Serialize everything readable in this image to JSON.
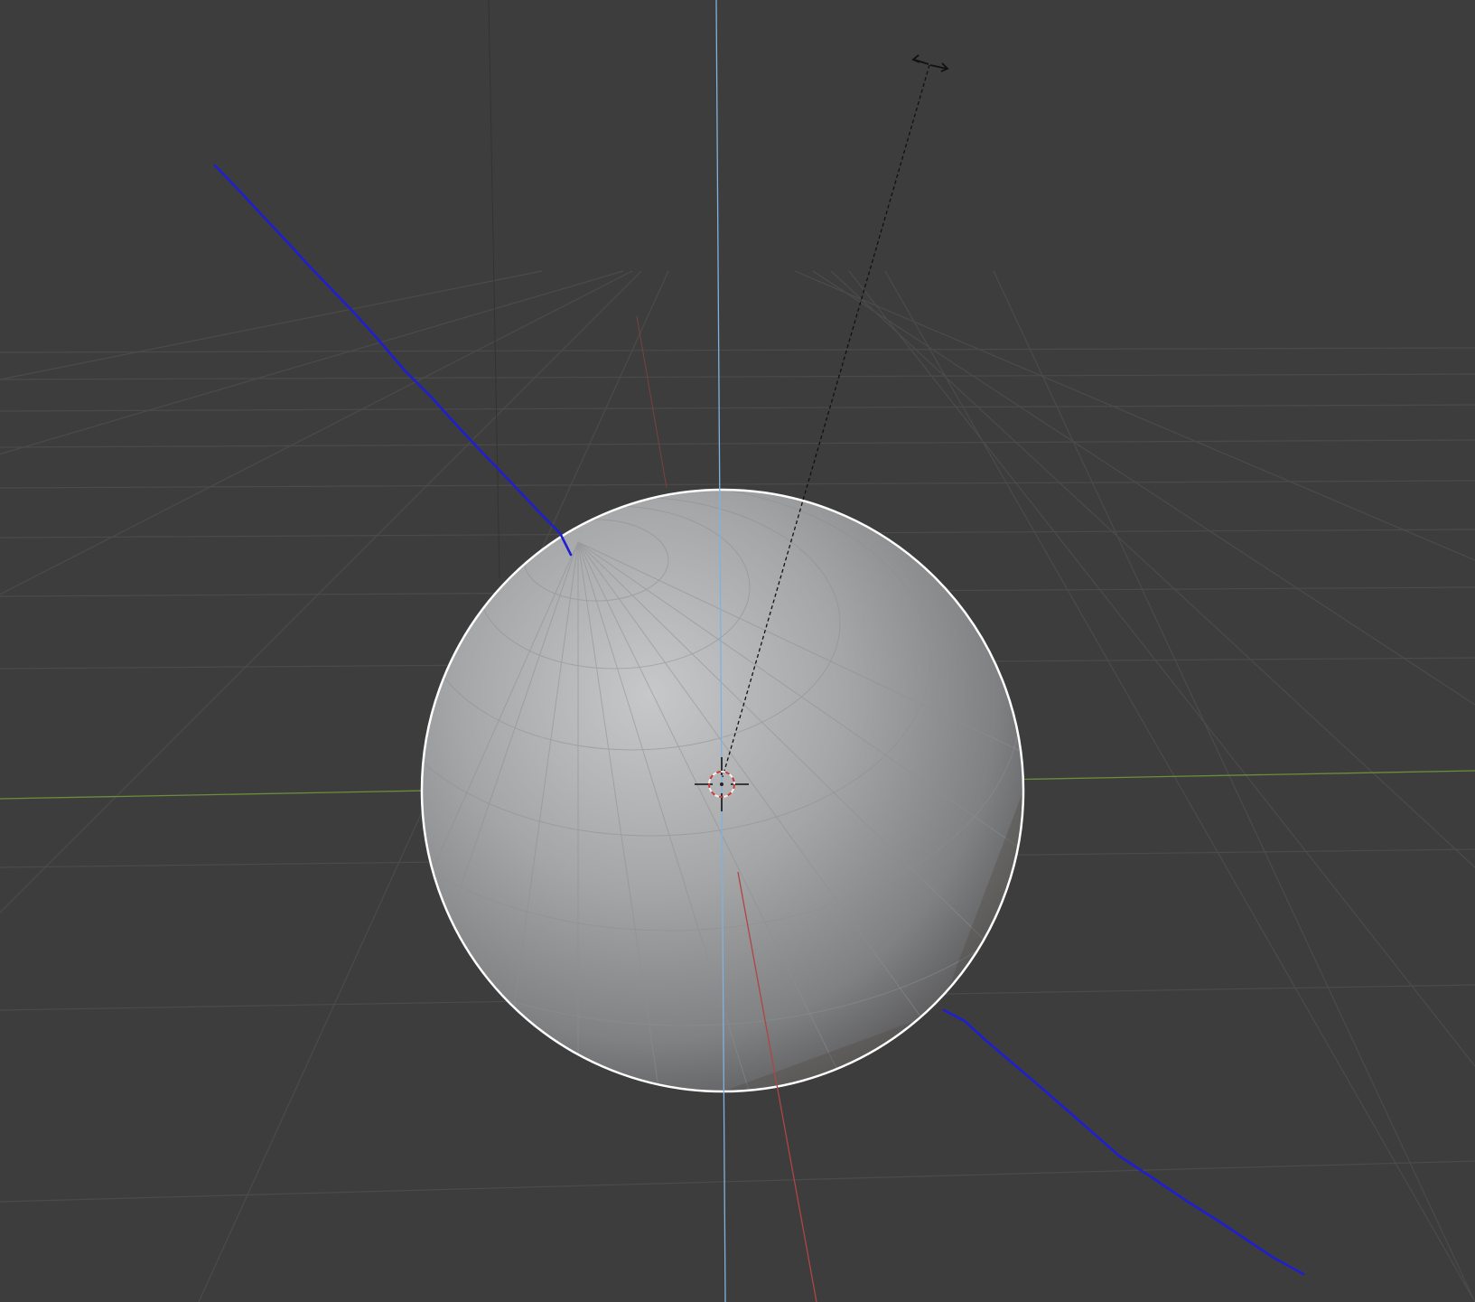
{
  "app": {
    "name": "3D Viewport"
  },
  "colors": {
    "background": "#3d3d3d",
    "grid_line": "#4a4a4a",
    "axis_x": "#a34b4b",
    "axis_y": "#6b8e3a",
    "axis_z": "#7fb2e0",
    "annotation_stroke": "#1f1fd1",
    "sphere_outline": "#ffffff",
    "sphere_light": "#c4c5c7",
    "sphere_mid": "#9a9b9d",
    "sphere_dark": "#5f5f60",
    "cursor_red": "#c83a3a",
    "cursor_white": "#f0f0f0"
  },
  "objects": [
    {
      "name": "uv-sphere",
      "type": "mesh",
      "selected": true
    },
    {
      "name": "light",
      "type": "light"
    }
  ],
  "icons": {
    "cursor": "3d-cursor-icon",
    "light": "light-direction-icon"
  }
}
